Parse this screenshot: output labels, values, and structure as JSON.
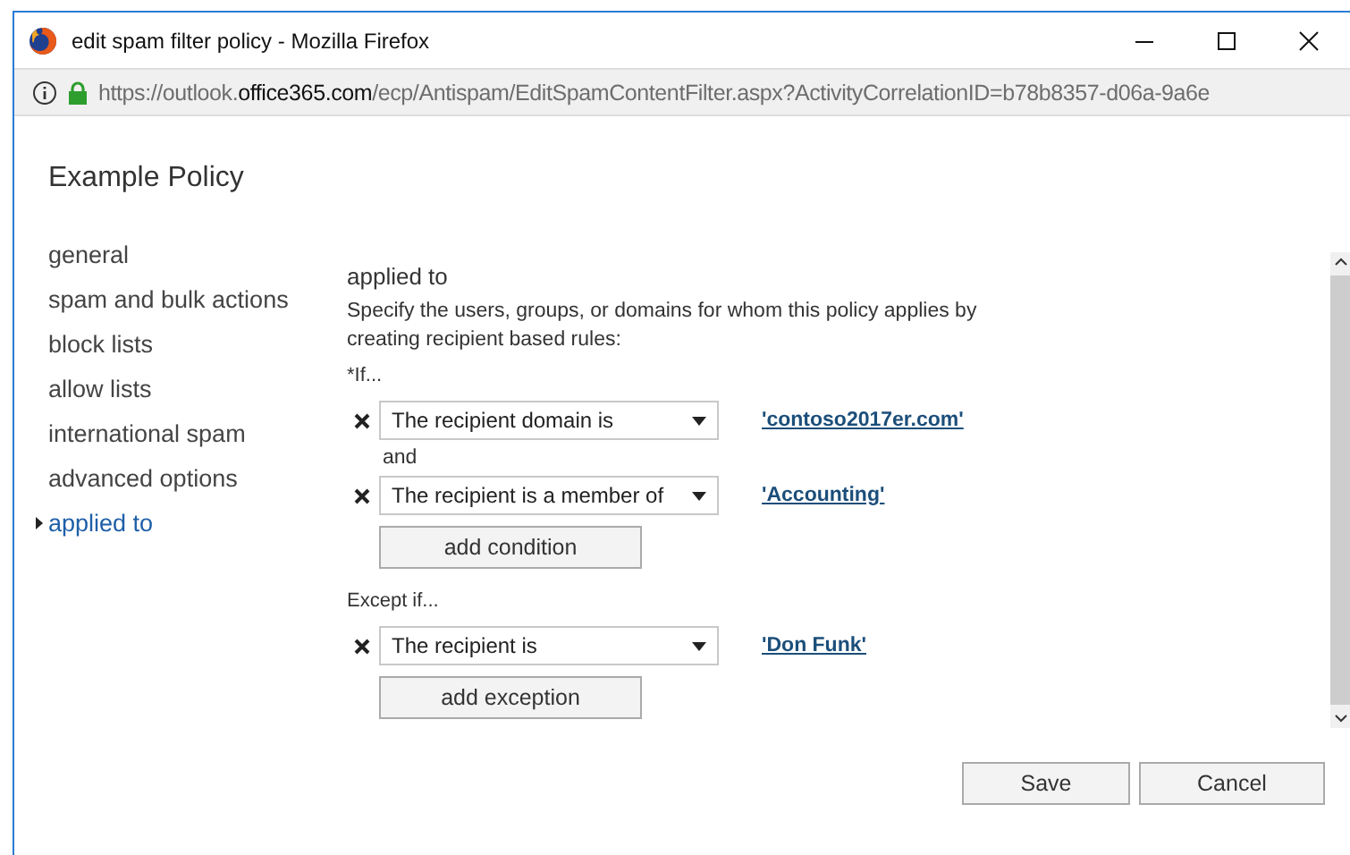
{
  "window": {
    "title": "edit spam filter policy - Mozilla Firefox"
  },
  "address_bar": {
    "url_parts": [
      {
        "text": "https://outlook.",
        "emphasis": false
      },
      {
        "text": "office365.com",
        "emphasis": true
      },
      {
        "text": "/ecp/Antispam/EditSpamContentFilter.aspx?ActivityCorrelationID=b78b8357-d06a-9a6e",
        "emphasis": false
      }
    ]
  },
  "heading": "Example Policy",
  "sidebar": {
    "items": [
      {
        "label": "general",
        "selected": false
      },
      {
        "label": "spam and bulk actions",
        "selected": false
      },
      {
        "label": "block lists",
        "selected": false
      },
      {
        "label": "allow lists",
        "selected": false
      },
      {
        "label": "international spam",
        "selected": false
      },
      {
        "label": "advanced options",
        "selected": false
      },
      {
        "label": "applied to",
        "selected": true
      }
    ]
  },
  "section": {
    "title": "applied to",
    "description": "Specify the users, groups, or domains for whom this policy applies by creating recipient based rules:",
    "groups": [
      {
        "label": "*If...",
        "rules": [
          {
            "condition": "The recipient domain is",
            "value": "'contoso2017er.com'"
          },
          {
            "connector": "and",
            "condition": "The recipient is a member of",
            "value": "'Accounting'"
          }
        ],
        "add_button": "add condition"
      },
      {
        "label": "Except if...",
        "rules": [
          {
            "condition": "The recipient is",
            "value": "'Don Funk'"
          }
        ],
        "add_button": "add exception"
      }
    ]
  },
  "buttons": [
    "Save",
    "Cancel"
  ]
}
